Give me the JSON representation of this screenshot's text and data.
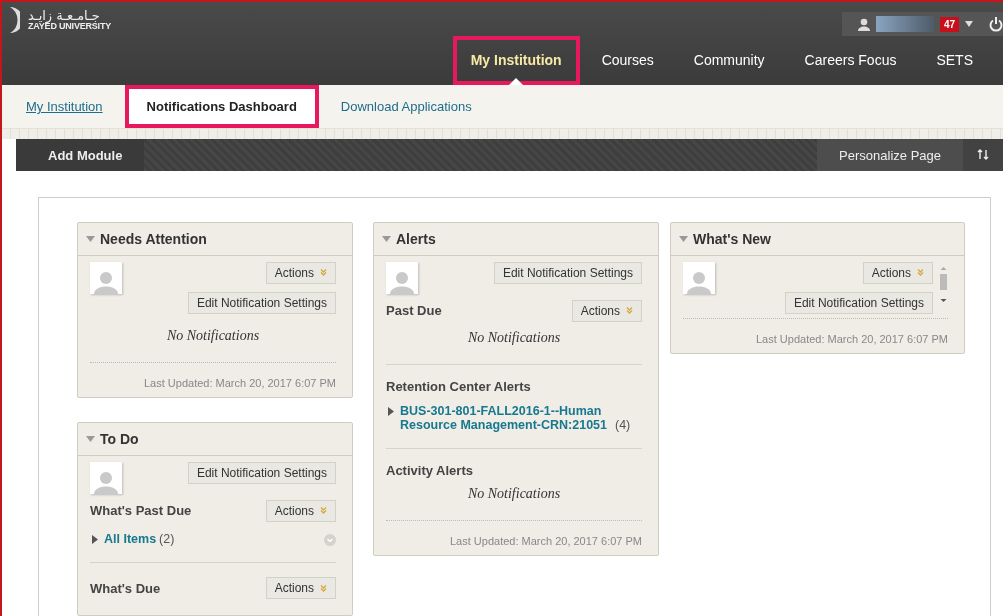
{
  "header": {
    "logo_arabic": "جـامـعـة زايـد",
    "logo_english": "ZAYED UNIVERSITY",
    "notification_count": "47",
    "nav": [
      {
        "label": "My Institution",
        "selected": true,
        "highlighted": true
      },
      {
        "label": "Courses",
        "selected": false,
        "highlighted": false
      },
      {
        "label": "Community",
        "selected": false,
        "highlighted": false
      },
      {
        "label": "Careers Focus",
        "selected": false,
        "highlighted": false
      },
      {
        "label": "SETS",
        "selected": false,
        "highlighted": false
      }
    ]
  },
  "subnav": [
    {
      "label": "My Institution",
      "selected": false,
      "highlighted": false
    },
    {
      "label": "Notifications Dashboard",
      "selected": true,
      "highlighted": true
    },
    {
      "label": "Download Applications",
      "selected": false,
      "highlighted": false
    }
  ],
  "toolbar": {
    "add_module": "Add Module",
    "personalize": "Personalize Page"
  },
  "columns": [
    [
      {
        "title": "Needs Attention",
        "expanded": true,
        "scrollable": false,
        "top_buttons": [
          {
            "kind": "actions",
            "label": "Actions"
          },
          {
            "kind": "settings",
            "label": "Edit Notification Settings"
          }
        ],
        "sections": [
          {
            "entries": [
              {
                "kind": "note",
                "text": "No Notifications"
              }
            ]
          }
        ],
        "last_updated": "Last Updated: March 20, 2017 6:07 PM"
      },
      {
        "title": "To Do",
        "expanded": true,
        "scrollable": false,
        "top_buttons": [
          {
            "kind": "settings",
            "label": "Edit Notification Settings"
          }
        ],
        "sections": [
          {
            "heading": "What's Past Due",
            "button": "Actions",
            "entries": [
              {
                "kind": "item",
                "label": "All Items",
                "count": "(2)",
                "expanded": false,
                "menu": true
              }
            ]
          },
          {
            "heading": "What's Due",
            "button": "Actions"
          }
        ]
      }
    ],
    [
      {
        "title": "Alerts",
        "expanded": true,
        "scrollable": false,
        "top_buttons": [
          {
            "kind": "settings",
            "label": "Edit Notification Settings"
          }
        ],
        "sections": [
          {
            "heading": "Past Due",
            "button": "Actions",
            "entries": [
              {
                "kind": "note",
                "text": "No Notifications"
              }
            ]
          },
          {
            "heading": "Retention Center Alerts",
            "entries": [
              {
                "kind": "item",
                "label": "BUS-301-801-FALL2016-1--Human Resource Management-CRN:21051",
                "count": "(4)",
                "expanded": false,
                "menu": false
              }
            ]
          },
          {
            "heading": "Activity Alerts",
            "entries": [
              {
                "kind": "note",
                "text": "No Notifications"
              }
            ]
          }
        ],
        "last_updated": "Last Updated: March 20, 2017 6:07 PM"
      }
    ],
    [
      {
        "title": "What's New",
        "expanded": true,
        "scrollable": true,
        "top_buttons": [
          {
            "kind": "actions",
            "label": "Actions"
          },
          {
            "kind": "settings",
            "label": "Edit Notification Settings"
          }
        ],
        "last_updated": "Last Updated: March 20, 2017 6:07 PM"
      }
    ]
  ]
}
